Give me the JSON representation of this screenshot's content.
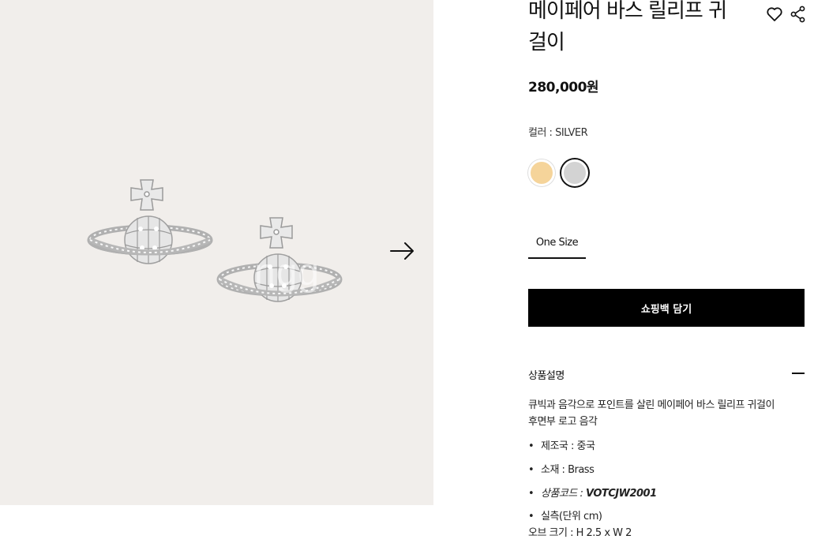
{
  "product": {
    "title": "메이페어 바스 릴리프 귀걸이",
    "price": "280,000원",
    "color_label": "컬러 : SILVER",
    "colors": [
      {
        "name": "gold",
        "hex": "#f5d49a"
      },
      {
        "name": "silver",
        "hex": "#d3d3d3"
      }
    ],
    "size_tab": "One Size",
    "cart_button": "쇼핑백 담기"
  },
  "gallery": {
    "background": "#f1eeeb",
    "watermark": "ngg"
  },
  "description": {
    "header": "상품설명",
    "lines": [
      "큐빅과 음각으로 포인트를 살린 메이페어 바스 릴리프 귀걸이",
      "후면부 로고 음각"
    ],
    "specs": {
      "origin": "제조국 : 중국",
      "material": "소재 : Brass",
      "code_label": "상품코드 : ",
      "code_value": "VOTCJW2001",
      "measure": "실측(단위 cm)",
      "orb_size": "오브 크기 : H 2.5 x W 2"
    },
    "bullet": "•"
  }
}
